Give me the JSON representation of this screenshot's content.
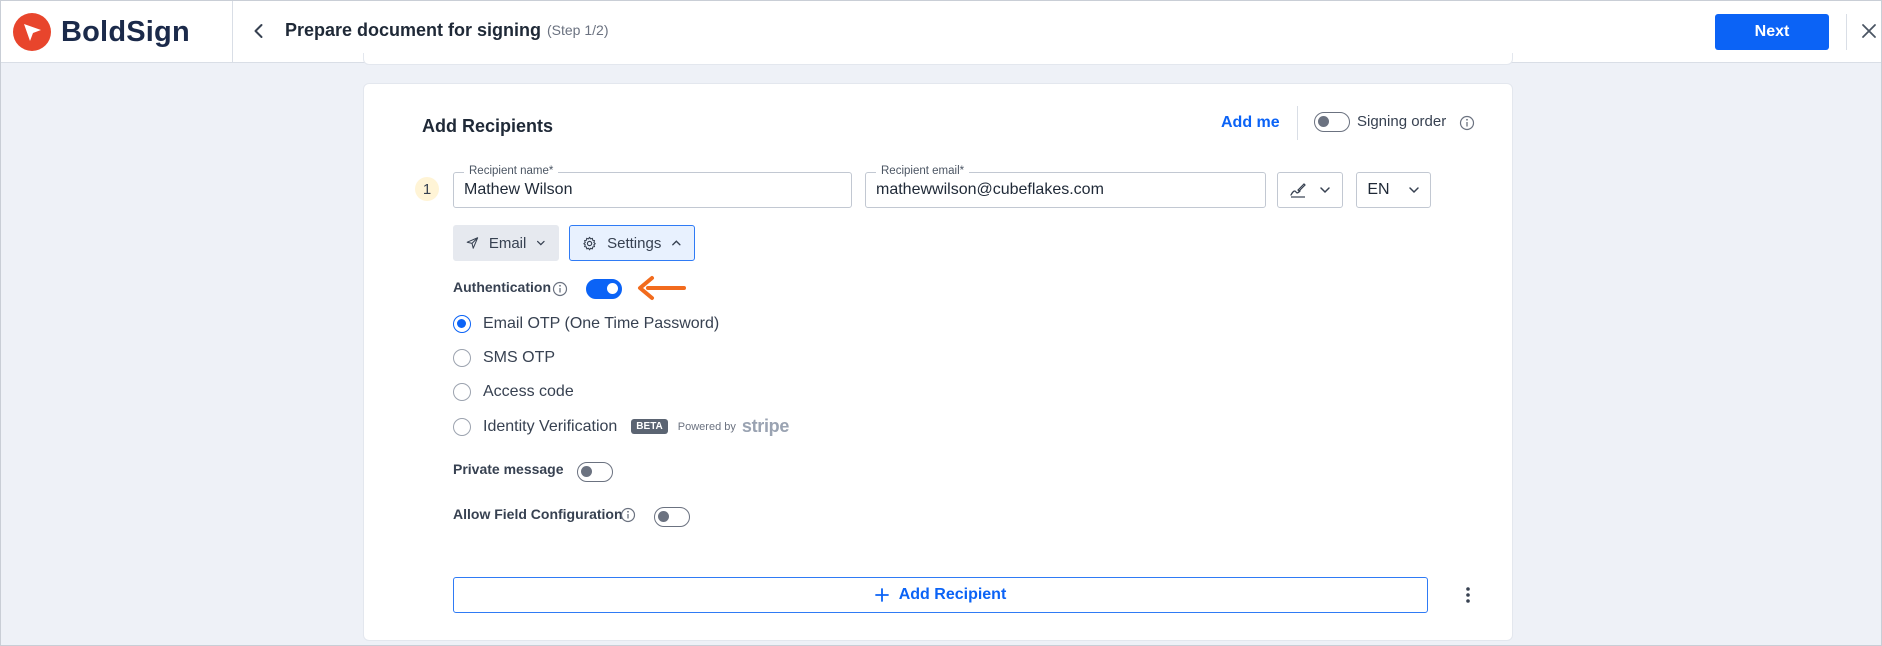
{
  "header": {
    "brand": "BoldSign",
    "title": "Prepare document for signing",
    "step": "(Step 1/2)",
    "next_label": "Next"
  },
  "section": {
    "title": "Add Recipients",
    "add_me_label": "Add me",
    "signing_order_label": "Signing order",
    "signing_order_enabled": false
  },
  "recipient": {
    "number": "1",
    "name_label": "Recipient name*",
    "name_value": "Mathew Wilson",
    "email_label": "Recipient email*",
    "email_value": "mathewwilson@cubeflakes.com",
    "language": "EN",
    "delivery_label": "Email",
    "settings_label": "Settings"
  },
  "authentication": {
    "label": "Authentication",
    "enabled": true,
    "options": [
      {
        "label": "Email OTP (One Time Password)",
        "selected": true
      },
      {
        "label": "SMS OTP",
        "selected": false
      },
      {
        "label": "Access code",
        "selected": false
      },
      {
        "label": "Identity Verification",
        "selected": false
      }
    ],
    "beta_badge": "BETA",
    "powered_by": "Powered by",
    "provider": "stripe"
  },
  "private_message": {
    "label": "Private message",
    "enabled": false
  },
  "allow_field_configuration": {
    "label": "Allow Field Configuration",
    "enabled": false
  },
  "add_recipient_label": "Add Recipient",
  "colors": {
    "primary": "#0b63f6",
    "brand_red": "#e8452c",
    "arrow_orange": "#f26b1d"
  }
}
